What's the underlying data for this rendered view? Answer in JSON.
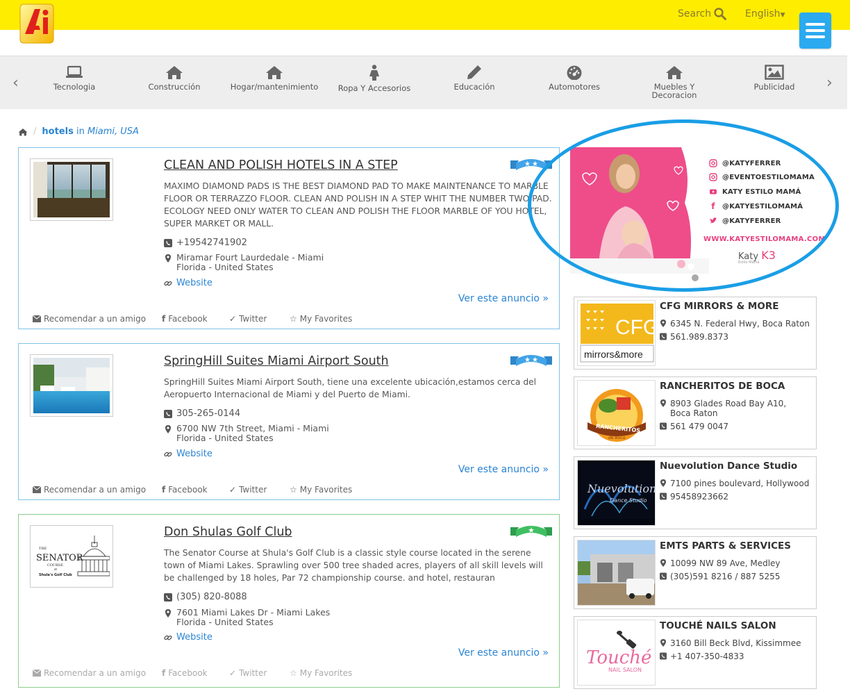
{
  "header": {
    "search_label": "Search",
    "language_label": "English",
    "brand_color": "#ffed00",
    "accent_color": "#2baaf0"
  },
  "categories": [
    {
      "label": "Tecnologia",
      "icon": "laptop-icon"
    },
    {
      "label": "Construcción",
      "icon": "home-icon"
    },
    {
      "label": "Hogar/mantenimiento",
      "icon": "home-icon"
    },
    {
      "label": "Ropa Y Accesorios",
      "icon": "female-icon"
    },
    {
      "label": "Educación",
      "icon": "pencil-icon"
    },
    {
      "label": "Automotores",
      "icon": "dashboard-icon"
    },
    {
      "label": "Muebles Y Decoracion",
      "icon": "home-icon"
    },
    {
      "label": "Publicidad",
      "icon": "picture-icon"
    }
  ],
  "breadcrumb": {
    "category": "hotels",
    "in": "in",
    "location": "Miami, USA"
  },
  "listings": [
    {
      "title": "CLEAN AND POLISH HOTELS IN A STEP",
      "description": "MAXIMO DIAMOND PADS IS THE BEST DIAMOND PAD TO MAKE MAINTENANCE TO MARBLE FLOOR OR TERRAZZO FLOOR. CLEAN AND POLISH IN A STEP WHIT THE NUMBER TWO PAD. ECOLOGY NEED ONLY WATER TO CLEAN AND POLISH THE FLOOR MARBLE OF YOU HOTEL, SUPER MARKET OR MALL.",
      "phone": "+19542741902",
      "address_line1": "Miramar Fourt Laurdedale - Miami",
      "address_line2": "Florida - United States",
      "website": "Website",
      "cta": "Ver este anuncio »",
      "ribbon": "two-star-ribbon-icon"
    },
    {
      "title": "SpringHill Suites Miami Airport South",
      "description": "SpringHill Suites Miami Airport South, tiene una excelente ubicación,estamos cerca del Aeropuerto Internacional de Miami y del Puerto de Miami.",
      "phone": "305-265-0144",
      "address_line1": "6700 NW 7th Street, Miami - Miami",
      "address_line2": "Florida - United States",
      "website": "Website",
      "cta": "Ver este anuncio »",
      "ribbon": "two-star-ribbon-icon"
    },
    {
      "title": "Don Shulas Golf Club",
      "description": "The Senator Course at Shula's Golf Club is a classic style course located in the serene town of Miami Lakes. Sprawling over 500 tree shaded acres, players of all skill levels will be challenged by 18 holes, Par 72 championship course. and hotel, restauran",
      "phone": "(305) 820-8088",
      "address_line1": "7601 Miami Lakes Dr - Miami Lakes",
      "address_line2": "Florida - United States",
      "website": "Website",
      "cta": "Ver este anuncio »",
      "ribbon": "one-star-ribbon-icon",
      "thumb_text": {
        "the": "THE",
        "senator": "SENATOR",
        "course": "COURSE",
        "at": "at",
        "club": "Shula's Golf Club"
      }
    }
  ],
  "actions": {
    "recommend": "Recomendar a un amigo",
    "facebook": "Facebook",
    "twitter": "Twitter",
    "favorites": "My Favorites"
  },
  "ad": {
    "social": [
      {
        "handle": "@KATYFERRER",
        "icon": "instagram-icon"
      },
      {
        "handle": "@EVENTOESTILOMAMA",
        "icon": "instagram-icon"
      },
      {
        "handle": "KATY ESTILO MAMÁ",
        "icon": "youtube-icon"
      },
      {
        "handle": "@KATYESTILOMAMÁ",
        "icon": "facebook-icon"
      },
      {
        "handle": "@KATYFERRER",
        "icon": "twitter-icon"
      }
    ],
    "url": "WWW.KATYESTILOMAMA.COM",
    "brand": "Katy",
    "brand_sub": "Estilo Mamá",
    "highlight_color": "#1a9ee6"
  },
  "businesses": [
    {
      "name": "CFG MIRRORS & MORE",
      "address": "6345 N. Federal Hwy, Boca Raton",
      "phone": "561.989.8373",
      "logo_text": "CFG",
      "logo_sub": "mirrors&more"
    },
    {
      "name": "RANCHERITOS DE BOCA",
      "address": "8903 Glades Road Bay A10, Boca Raton",
      "phone": "561 479 0047",
      "logo_text": "RANCHERITOS",
      "logo_sub": "de Boca"
    },
    {
      "name": "Nuevolution Dance Studio",
      "address": "7100 pines boulevard, Hollywood",
      "phone": "95458923662",
      "logo_text": "Nuevolution",
      "logo_sub": "Dance Studio"
    },
    {
      "name": "EMTS PARTS & SERVICES",
      "address": "10099 NW 89 Ave, Medley",
      "phone": "(305)591 8216 / 887 5255"
    },
    {
      "name": "TOUCHÉ NAILS SALON",
      "address": "3160 Bill Beck Blvd, Kissimmee",
      "phone": "+1 407-350-4833",
      "logo_text": "Touché",
      "logo_sub": "NAIL SALON"
    }
  ]
}
